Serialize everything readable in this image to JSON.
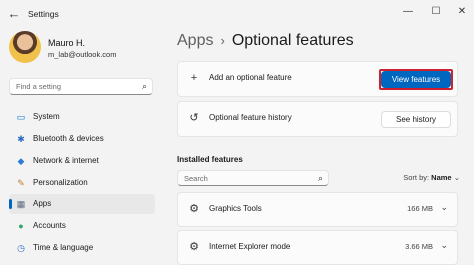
{
  "window": {
    "title": "Settings",
    "back_glyph": "←",
    "min_glyph": "—",
    "max_glyph": "☐",
    "close_glyph": "✕"
  },
  "user": {
    "name": "Mauro H.",
    "email": "m_lab@outlook.com"
  },
  "sidebar": {
    "search_placeholder": "Find a setting",
    "search_icon": "⌕",
    "items": [
      {
        "label": "System",
        "icon": "▭",
        "icon_color": "#0078d4"
      },
      {
        "label": "Bluetooth & devices",
        "icon": "✱",
        "icon_color": "#2b6cc4"
      },
      {
        "label": "Network & internet",
        "icon": "◆",
        "icon_color": "#2d7dd2"
      },
      {
        "label": "Personalization",
        "icon": "✎",
        "icon_color": "#c27a30"
      },
      {
        "label": "Apps",
        "icon": "▦",
        "icon_color": "#5b6b7a",
        "active": true
      },
      {
        "label": "Accounts",
        "icon": "●",
        "icon_color": "#2fa86f"
      },
      {
        "label": "Time & language",
        "icon": "◷",
        "icon_color": "#2b6cc4"
      }
    ]
  },
  "breadcrumb": {
    "parent": "Apps",
    "separator": "›",
    "current": "Optional features"
  },
  "add_feature": {
    "icon": "+",
    "label": "Add an optional feature",
    "button": "View features"
  },
  "history": {
    "icon": "↺",
    "label": "Optional feature history",
    "button": "See history"
  },
  "installed": {
    "title": "Installed features",
    "search_placeholder": "Search",
    "search_icon": "⌕",
    "sort_label": "Sort by:",
    "sort_value": "Name",
    "sort_chevron": "⌄",
    "features": [
      {
        "icon": "⚙",
        "name": "Graphics Tools",
        "size": "166 MB",
        "chevron": "⌄"
      },
      {
        "icon": "⚙",
        "name": "Internet Explorer mode",
        "size": "3.66 MB",
        "chevron": "⌄"
      }
    ]
  }
}
